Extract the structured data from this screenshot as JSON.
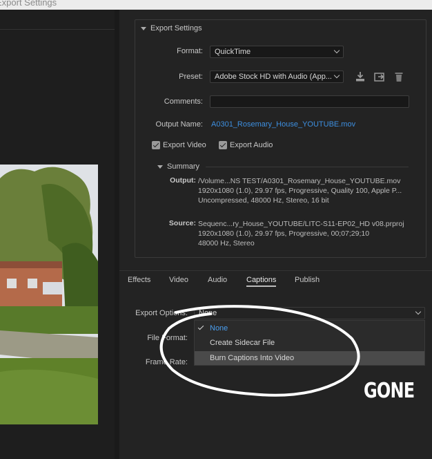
{
  "window": {
    "title": "Export Settings"
  },
  "export_settings": {
    "header": "Export Settings",
    "format_label": "Format:",
    "format_value": "QuickTime",
    "preset_label": "Preset:",
    "preset_value": "Adobe Stock HD with Audio (App...",
    "comments_label": "Comments:",
    "comments_value": "",
    "output_name_label": "Output Name:",
    "output_name_value": "A0301_Rosemary_House_YOUTUBE.mov",
    "export_video_label": "Export Video",
    "export_video_checked": true,
    "export_audio_label": "Export Audio",
    "export_audio_checked": true
  },
  "summary": {
    "header": "Summary",
    "output_label": "Output:",
    "output_lines": [
      "/Volume...NS TEST/A0301_Rosemary_House_YOUTUBE.mov",
      "1920x1080 (1.0), 29.97 fps, Progressive, Quality 100, Apple P...",
      "Uncompressed, 48000 Hz, Stereo, 16 bit"
    ],
    "source_label": "Source:",
    "source_lines": [
      "Sequenc...ry_House_YOUTUBE/LITC-S11-EP02_HD v08.prproj",
      "1920x1080 (1.0), 29.97 fps, Progressive, 00;07;29;10",
      "48000 Hz, Stereo"
    ]
  },
  "tabs": [
    {
      "label": "Effects",
      "active": false
    },
    {
      "label": "Video",
      "active": false
    },
    {
      "label": "Audio",
      "active": false
    },
    {
      "label": "Captions",
      "active": true
    },
    {
      "label": "Publish",
      "active": false
    }
  ],
  "captions": {
    "export_options_label": "Export Options:",
    "export_options_value": "None",
    "file_format_label": "File Format:",
    "frame_rate_label": "Frame Rate:",
    "dropdown_options": [
      "None",
      "Create Sidecar File",
      "Burn Captions Into Video"
    ],
    "selected_option": "None",
    "hovered_option": "Burn Captions Into Video"
  },
  "annotation": {
    "text": "GONE"
  },
  "icons": [
    "import-preset-icon",
    "save-preset-icon",
    "delete-preset-icon",
    "chevron-down-icon",
    "checkmark-icon"
  ],
  "colors": {
    "accent": "#3d8fe0",
    "background": "#232323",
    "highlight": "#4a4a4a"
  }
}
